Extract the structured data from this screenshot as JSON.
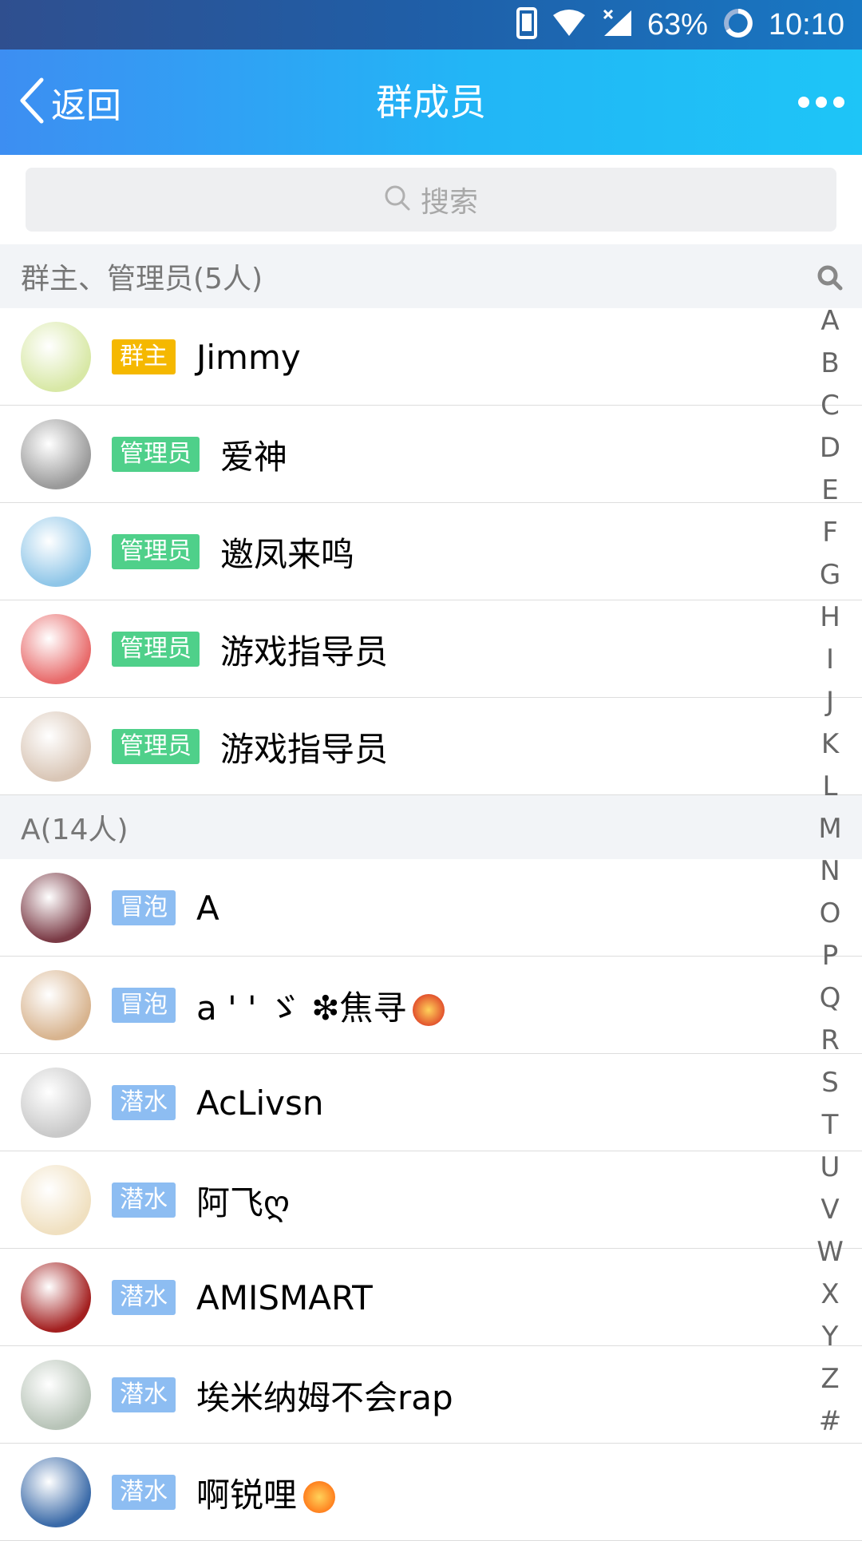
{
  "status_bar": {
    "battery": "63%",
    "time": "10:10"
  },
  "header": {
    "back_label": "返回",
    "title": "群成员"
  },
  "search": {
    "placeholder": "搜索"
  },
  "sections": [
    {
      "title": "群主、管理员(5人)",
      "members": [
        {
          "badge": "群主",
          "badge_color": "#f5b800",
          "name": "Jimmy",
          "avatar_color": "#d8e8a6"
        },
        {
          "badge": "管理员",
          "badge_color": "#4fd08a",
          "name": "爱神",
          "avatar_color": "#9a9a9a"
        },
        {
          "badge": "管理员",
          "badge_color": "#4fd08a",
          "name": "邀凤来鸣",
          "avatar_color": "#8fc6e8"
        },
        {
          "badge": "管理员",
          "badge_color": "#4fd08a",
          "name": "游戏指导员",
          "avatar_color": "#e86a6a"
        },
        {
          "badge": "管理员",
          "badge_color": "#4fd08a",
          "name": "游戏指导员",
          "avatar_color": "#d9c6b6"
        }
      ]
    },
    {
      "title": "A(14人)",
      "members": [
        {
          "badge": "冒泡",
          "badge_color": "#8dbdf2",
          "name": "A",
          "avatar_color": "#7a3a45"
        },
        {
          "badge": "冒泡",
          "badge_color": "#8dbdf2",
          "name": "a ' ' ゞ ❇焦寻",
          "emoji": "rose-icon",
          "emoji_color": "#e04a2a",
          "avatar_color": "#d8b48f"
        },
        {
          "badge": "潜水",
          "badge_color": "#8dbdf2",
          "name": "AcLivsn",
          "avatar_color": "#c9c9c9"
        },
        {
          "badge": "潜水",
          "badge_color": "#8dbdf2",
          "name": "阿飞ღ",
          "avatar_color": "#f0e0c0"
        },
        {
          "badge": "潜水",
          "badge_color": "#8dbdf2",
          "name": "AMISMART",
          "avatar_color": "#a32020"
        },
        {
          "badge": "潜水",
          "badge_color": "#8dbdf2",
          "name": "埃米纳姆不会rap",
          "avatar_color": "#b8c4b8"
        },
        {
          "badge": "潜水",
          "badge_color": "#8dbdf2",
          "name": "啊锐哩",
          "emoji": "collision-icon",
          "emoji_color": "#ff7a1a",
          "avatar_color": "#3a6aa8"
        }
      ]
    }
  ],
  "index_bar": [
    "A",
    "B",
    "C",
    "D",
    "E",
    "F",
    "G",
    "H",
    "I",
    "J",
    "K",
    "L",
    "M",
    "N",
    "O",
    "P",
    "Q",
    "R",
    "S",
    "T",
    "U",
    "V",
    "W",
    "X",
    "Y",
    "Z",
    "#"
  ]
}
